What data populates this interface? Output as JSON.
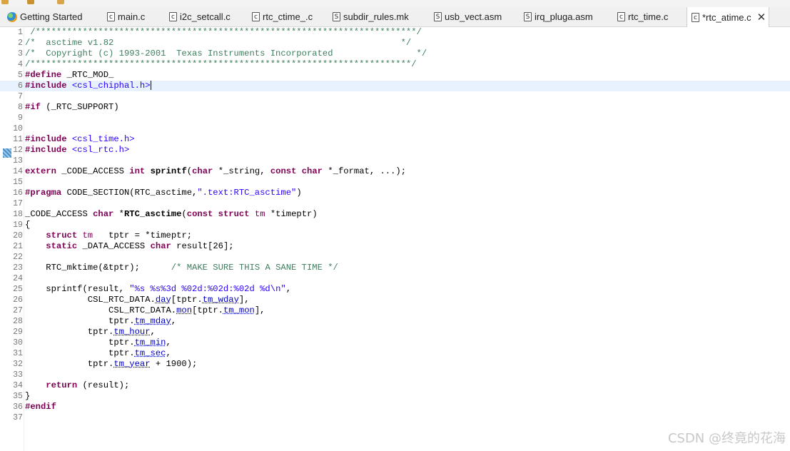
{
  "tabs": [
    {
      "label": "Getting Started",
      "icon": "getting-started-icon"
    },
    {
      "label": "main.c",
      "icon": "c-file-icon"
    },
    {
      "label": "i2c_setcall.c",
      "icon": "c-file-icon"
    },
    {
      "label": "rtc_ctime_.c",
      "icon": "c-file-icon"
    },
    {
      "label": "subdir_rules.mk",
      "icon": "s-file-icon"
    },
    {
      "label": "usb_vect.asm",
      "icon": "s-file-icon"
    },
    {
      "label": "irq_pluga.asm",
      "icon": "s-file-icon"
    },
    {
      "label": "rtc_time.c",
      "icon": "c-file-icon"
    },
    {
      "label": "*rtc_atime.c",
      "icon": "c-file-icon",
      "active": true
    }
  ],
  "icon_letters": {
    "c": "c",
    "s": "S"
  },
  "close_glyph": "✕",
  "lines": [
    {
      "n": "1",
      "segs": [
        [
          "cm",
          " /*************************************************************************/"
        ]
      ]
    },
    {
      "n": "2",
      "segs": [
        [
          "cm",
          "/*  asctime v1.82                                                       */"
        ]
      ]
    },
    {
      "n": "3",
      "segs": [
        [
          "cm",
          "/*  Copyright (c) 1993-2001  Texas Instruments Incorporated                */"
        ]
      ]
    },
    {
      "n": "4",
      "segs": [
        [
          "cm",
          "/*************************************************************************/"
        ]
      ]
    },
    {
      "n": "5",
      "segs": [
        [
          "kw",
          "#define"
        ],
        [
          "",
          " _RTC_MOD_"
        ]
      ]
    },
    {
      "n": "6",
      "segs": [
        [
          "kw",
          "#include"
        ],
        [
          "",
          " "
        ],
        [
          "str",
          "<csl_chiphal.h>"
        ]
      ],
      "current": true,
      "caret": true
    },
    {
      "n": "7",
      "segs": []
    },
    {
      "n": "8",
      "segs": [
        [
          "kw",
          "#if"
        ],
        [
          "",
          " (_RTC_SUPPORT)"
        ]
      ]
    },
    {
      "n": "9",
      "segs": []
    },
    {
      "n": "10",
      "segs": []
    },
    {
      "n": "11",
      "segs": [
        [
          "kw",
          "#include"
        ],
        [
          "",
          " "
        ],
        [
          "str",
          "<csl_time.h>"
        ]
      ]
    },
    {
      "n": "12",
      "segs": [
        [
          "kw",
          "#include"
        ],
        [
          "",
          " "
        ],
        [
          "str",
          "<csl_rtc.h>"
        ]
      ]
    },
    {
      "n": "13",
      "segs": []
    },
    {
      "n": "14",
      "segs": [
        [
          "kw",
          "extern"
        ],
        [
          "",
          " _CODE_ACCESS "
        ],
        [
          "kw",
          "int"
        ],
        [
          "",
          " "
        ],
        [
          "b",
          "sprintf"
        ],
        [
          "",
          "("
        ],
        [
          "kw",
          "char"
        ],
        [
          "",
          " *_string, "
        ],
        [
          "kw",
          "const"
        ],
        [
          "",
          " "
        ],
        [
          "kw",
          "char"
        ],
        [
          "",
          " *_format, ...);"
        ]
      ]
    },
    {
      "n": "15",
      "segs": []
    },
    {
      "n": "16",
      "segs": [
        [
          "kw",
          "#pragma"
        ],
        [
          "",
          " CODE_SECTION(RTC_asctime,"
        ],
        [
          "str",
          "\".text:RTC_asctime\""
        ],
        [
          "",
          ")"
        ]
      ]
    },
    {
      "n": "17",
      "segs": []
    },
    {
      "n": "18",
      "segs": [
        [
          "",
          "_CODE_ACCESS "
        ],
        [
          "kw",
          "char"
        ],
        [
          "",
          " *"
        ],
        [
          "b",
          "RTC_asctime"
        ],
        [
          "",
          "("
        ],
        [
          "kw",
          "const"
        ],
        [
          "",
          " "
        ],
        [
          "kw",
          "struct"
        ],
        [
          "",
          " "
        ],
        [
          "kt",
          "tm"
        ],
        [
          "",
          " *timeptr)"
        ]
      ]
    },
    {
      "n": "19",
      "segs": [
        [
          "",
          "{"
        ]
      ]
    },
    {
      "n": "20",
      "segs": [
        [
          "",
          "    "
        ],
        [
          "kw",
          "struct"
        ],
        [
          "",
          " "
        ],
        [
          "kt",
          "tm"
        ],
        [
          "",
          "   tptr = *timeptr;"
        ]
      ]
    },
    {
      "n": "21",
      "segs": [
        [
          "",
          "    "
        ],
        [
          "kw",
          "static"
        ],
        [
          "",
          " _DATA_ACCESS "
        ],
        [
          "kw",
          "char"
        ],
        [
          "",
          " result[26];"
        ]
      ]
    },
    {
      "n": "22",
      "segs": []
    },
    {
      "n": "23",
      "segs": [
        [
          "",
          "    RTC_mktime(&tptr);      "
        ],
        [
          "cm",
          "/* MAKE SURE THIS A SANE TIME */"
        ]
      ]
    },
    {
      "n": "24",
      "segs": []
    },
    {
      "n": "25",
      "segs": [
        [
          "",
          "    sprintf(result, "
        ],
        [
          "str",
          "\"%s %s%3d %02d:%02d:%02d %d\\n\""
        ],
        [
          "",
          ","
        ]
      ]
    },
    {
      "n": "26",
      "segs": [
        [
          "",
          "            CSL_RTC_DATA."
        ],
        [
          "fld",
          "day"
        ],
        [
          "",
          "[tptr."
        ],
        [
          "fld",
          "tm_wday"
        ],
        [
          "",
          "],"
        ]
      ]
    },
    {
      "n": "27",
      "segs": [
        [
          "",
          "                CSL_RTC_DATA."
        ],
        [
          "fld",
          "mon"
        ],
        [
          "",
          "[tptr."
        ],
        [
          "fld",
          "tm_mon"
        ],
        [
          "",
          "],"
        ]
      ]
    },
    {
      "n": "28",
      "segs": [
        [
          "",
          "                tptr."
        ],
        [
          "fld",
          "tm_mday"
        ],
        [
          "",
          ","
        ]
      ]
    },
    {
      "n": "29",
      "segs": [
        [
          "",
          "            tptr."
        ],
        [
          "fld",
          "tm_hour"
        ],
        [
          "",
          ","
        ]
      ]
    },
    {
      "n": "30",
      "segs": [
        [
          "",
          "                tptr."
        ],
        [
          "fld",
          "tm_min"
        ],
        [
          "",
          ","
        ]
      ]
    },
    {
      "n": "31",
      "segs": [
        [
          "",
          "                tptr."
        ],
        [
          "fld",
          "tm_sec"
        ],
        [
          "",
          ","
        ]
      ]
    },
    {
      "n": "32",
      "segs": [
        [
          "",
          "            tptr."
        ],
        [
          "fld",
          "tm_year"
        ],
        [
          "",
          " + 1900);"
        ]
      ]
    },
    {
      "n": "33",
      "segs": []
    },
    {
      "n": "34",
      "segs": [
        [
          "",
          "    "
        ],
        [
          "kw",
          "return"
        ],
        [
          "",
          " (result);"
        ]
      ]
    },
    {
      "n": "35",
      "segs": [
        [
          "",
          "}"
        ]
      ]
    },
    {
      "n": "36",
      "segs": [
        [
          "kw",
          "#endif"
        ]
      ]
    },
    {
      "n": "37",
      "segs": []
    }
  ],
  "watermark": "CSDN @终竟的花海"
}
